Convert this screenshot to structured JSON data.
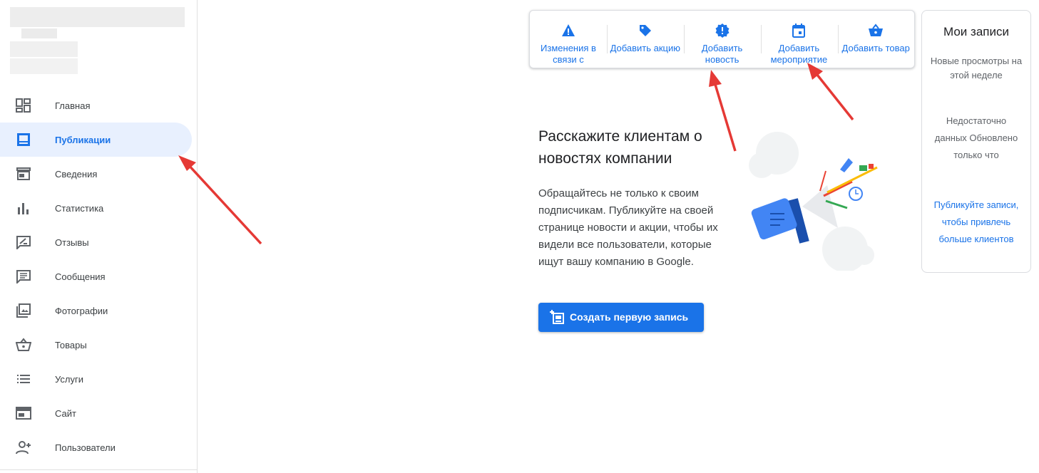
{
  "sidebar": {
    "items": [
      {
        "label": "Главная",
        "icon": "dashboard-icon"
      },
      {
        "label": "Публикации",
        "icon": "posts-icon",
        "active": true
      },
      {
        "label": "Сведения",
        "icon": "storefront-icon"
      },
      {
        "label": "Статистика",
        "icon": "bar-chart-icon"
      },
      {
        "label": "Отзывы",
        "icon": "review-icon"
      },
      {
        "label": "Сообщения",
        "icon": "chat-icon"
      },
      {
        "label": "Фотографии",
        "icon": "photo-library-icon"
      },
      {
        "label": "Товары",
        "icon": "basket-icon"
      },
      {
        "label": "Услуги",
        "icon": "list-icon"
      },
      {
        "label": "Сайт",
        "icon": "web-icon"
      },
      {
        "label": "Пользователи",
        "icon": "add-person-icon"
      }
    ]
  },
  "toolbar": {
    "buttons": [
      {
        "label": "Изменения в связи с",
        "icon": "warning-icon"
      },
      {
        "label": "Добавить акцию",
        "icon": "tag-icon"
      },
      {
        "label": "Добавить новость",
        "icon": "alert-badge-icon"
      },
      {
        "label": "Добавить мероприятие",
        "icon": "calendar-icon"
      },
      {
        "label": "Добавить товар",
        "icon": "basket-icon"
      }
    ]
  },
  "main": {
    "headline": "Расскажите клиентам о новостях компании",
    "description": "Обращайтесь не только к своим подписчикам. Публикуйте на своей странице новости и акции, чтобы их видели все пользователи, которые ищут вашу компанию в Google.",
    "cta_label": "Создать первую запись"
  },
  "records": {
    "title": "Мои записи",
    "new_views": "Новые просмотры на этой неделе",
    "status": "Недостаточно данных Обновлено только что",
    "link": "Публикуйте записи, чтобы привлечь больше клиентов"
  },
  "colors": {
    "accent": "#1a73e8",
    "active_bg": "#e8f0fe",
    "arrow": "#e53935"
  }
}
